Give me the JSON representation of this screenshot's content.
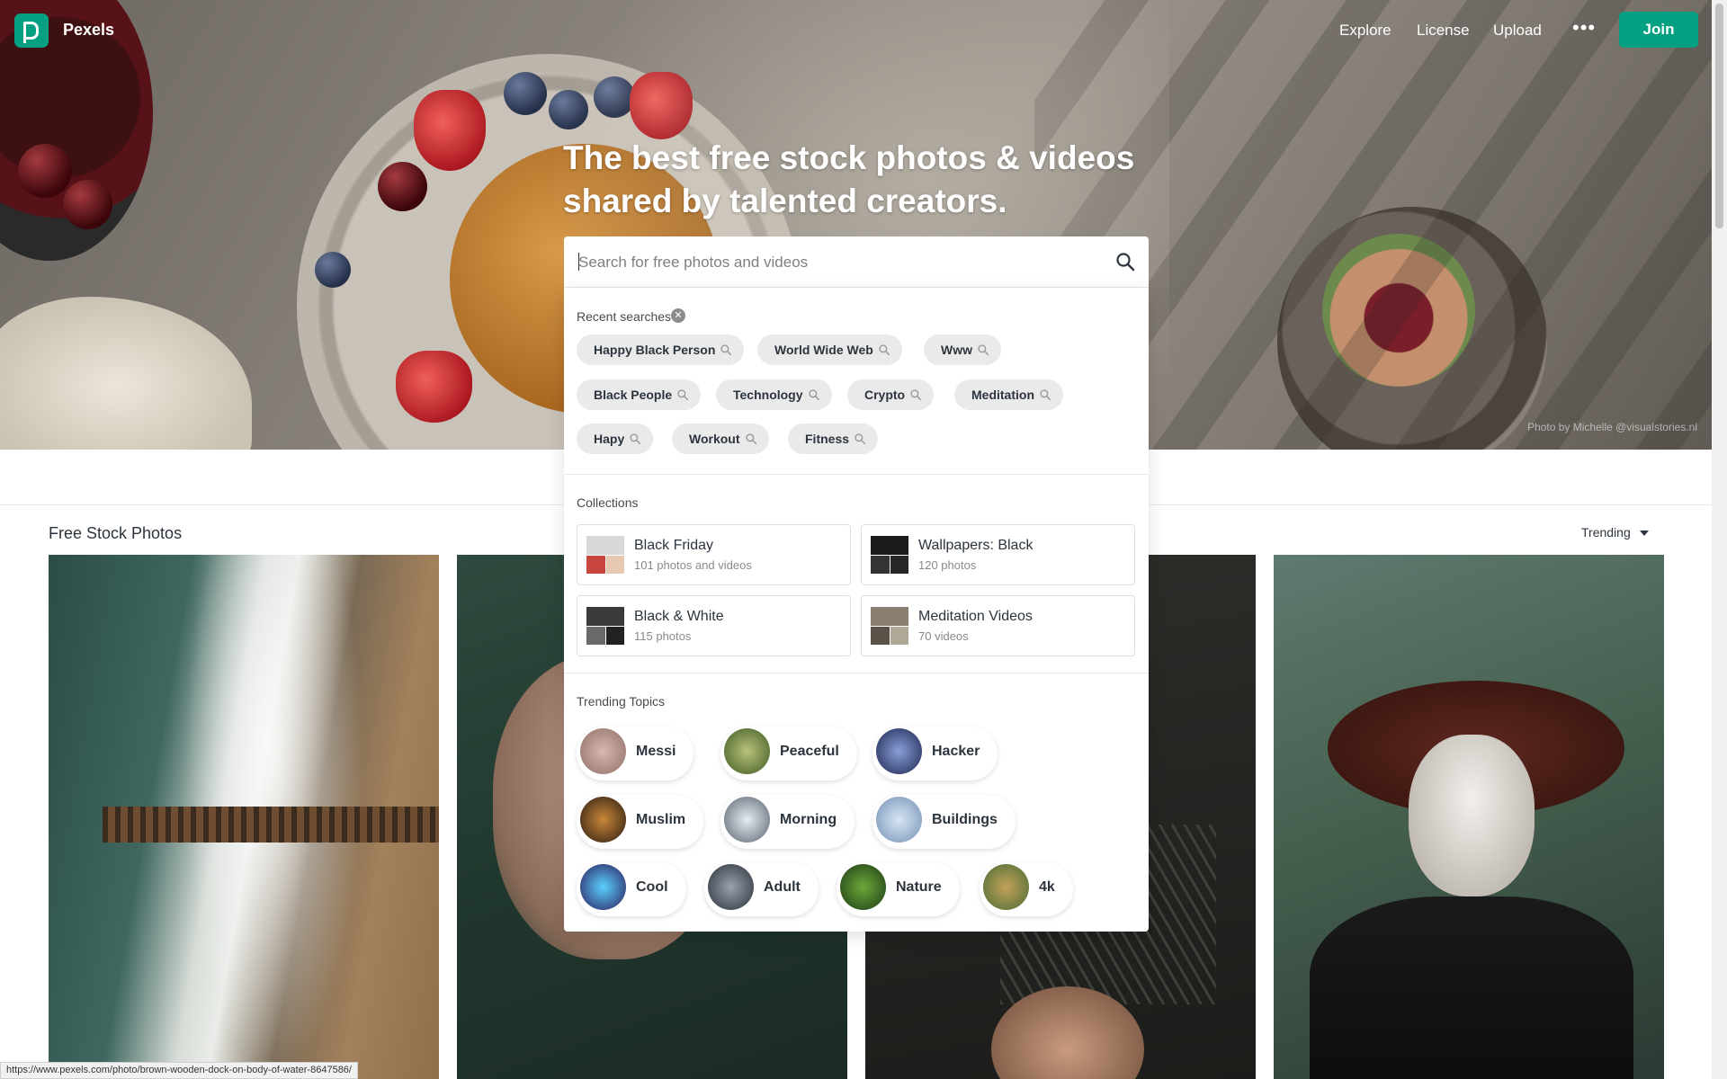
{
  "brand": {
    "name": "Pexels",
    "accent": "#05a081"
  },
  "nav": {
    "explore": "Explore",
    "license": "License",
    "upload": "Upload",
    "more": "•••",
    "join": "Join"
  },
  "hero": {
    "title": "The best free stock photos & videos shared by talented creators.",
    "credit": "Photo by Michelle @visualstories.nl"
  },
  "search": {
    "placeholder": "Search for free photos and videos",
    "value": ""
  },
  "recent": {
    "label": "Recent searches",
    "items": [
      "Happy Black Person",
      "World Wide Web",
      "Www",
      "Black People",
      "Technology",
      "Crypto",
      "Meditation",
      "Hapy",
      "Workout",
      "Fitness"
    ]
  },
  "collections": {
    "label": "Collections",
    "items": [
      {
        "name": "Black Friday",
        "count": "101 photos and videos"
      },
      {
        "name": "Wallpapers: Black",
        "count": "120 photos"
      },
      {
        "name": "Black & White",
        "count": "115 photos"
      },
      {
        "name": "Meditation Videos",
        "count": "70 videos"
      }
    ]
  },
  "trending": {
    "label": "Trending Topics",
    "items": [
      "Messi",
      "Peaceful",
      "Hacker",
      "Muslim",
      "Morning",
      "Buildings",
      "Cool",
      "Adult",
      "Nature",
      "4k"
    ]
  },
  "gallery": {
    "title": "Free Stock Photos",
    "sort": "Trending"
  },
  "status_url": "https://www.pexels.com/photo/brown-wooden-dock-on-body-of-water-8647586/"
}
